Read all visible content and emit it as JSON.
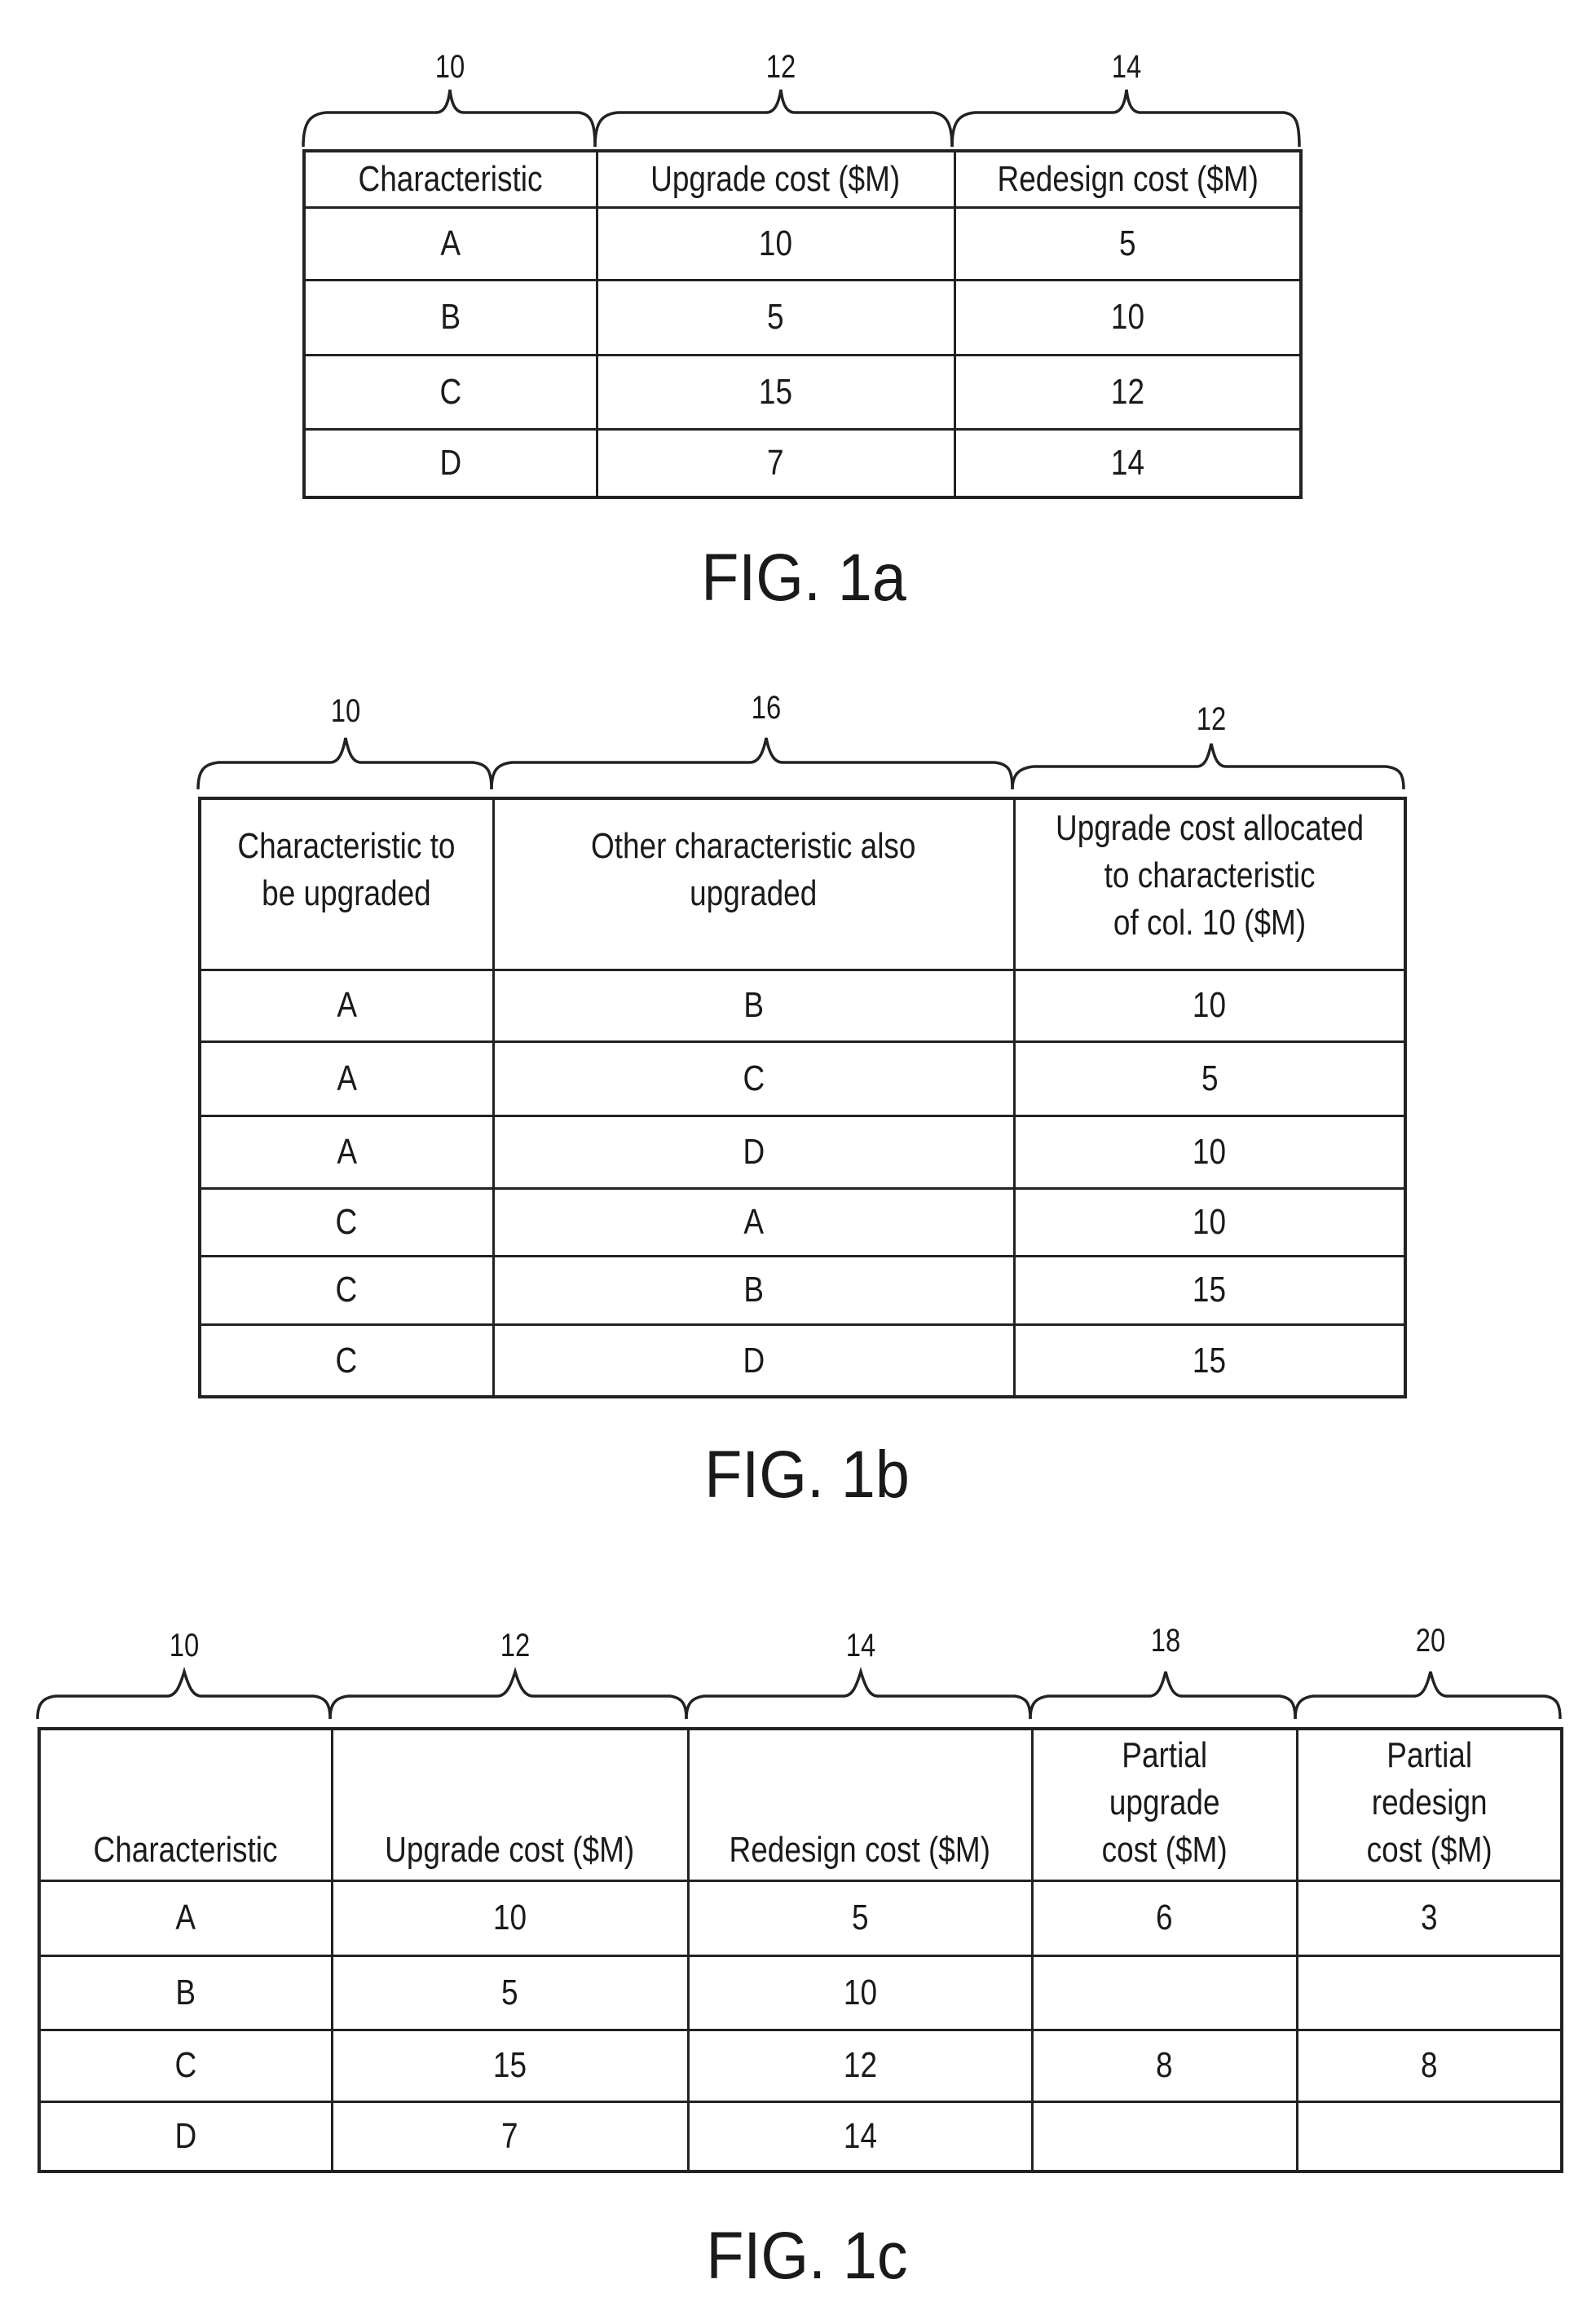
{
  "figures": {
    "fig1a": {
      "caption": "FIG. 1a",
      "ref_labels": [
        "10",
        "12",
        "14"
      ],
      "headers": [
        "Characteristic",
        "Upgrade cost ($M)",
        "Redesign cost ($M)"
      ],
      "rows": [
        [
          "A",
          "10",
          "5"
        ],
        [
          "B",
          "5",
          "10"
        ],
        [
          "C",
          "15",
          "12"
        ],
        [
          "D",
          "7",
          "14"
        ]
      ]
    },
    "fig1b": {
      "caption": "FIG. 1b",
      "ref_labels": [
        "10",
        "16",
        "12"
      ],
      "headers": [
        [
          "Characteristic to",
          "be upgraded"
        ],
        [
          "Other characteristic also",
          "upgraded"
        ],
        [
          "Upgrade cost allocated",
          "to characteristic",
          "of col. 10  ($M)"
        ]
      ],
      "rows": [
        [
          "A",
          "B",
          "10"
        ],
        [
          "A",
          "C",
          "5"
        ],
        [
          "A",
          "D",
          "10"
        ],
        [
          "C",
          "A",
          "10"
        ],
        [
          "C",
          "B",
          "15"
        ],
        [
          "C",
          "D",
          "15"
        ]
      ]
    },
    "fig1c": {
      "caption": "FIG. 1c",
      "ref_labels": [
        "10",
        "12",
        "14",
        "18",
        "20"
      ],
      "headers": [
        [
          "Characteristic"
        ],
        [
          "Upgrade cost ($M)"
        ],
        [
          "Redesign cost ($M)"
        ],
        [
          "Partial",
          "upgrade",
          "cost ($M)"
        ],
        [
          "Partial",
          "redesign",
          "cost ($M)"
        ]
      ],
      "rows": [
        [
          "A",
          "10",
          "5",
          "6",
          "3"
        ],
        [
          "B",
          "5",
          "10",
          "",
          ""
        ],
        [
          "C",
          "15",
          "12",
          "8",
          "8"
        ],
        [
          "D",
          "7",
          "14",
          "",
          ""
        ]
      ]
    }
  }
}
